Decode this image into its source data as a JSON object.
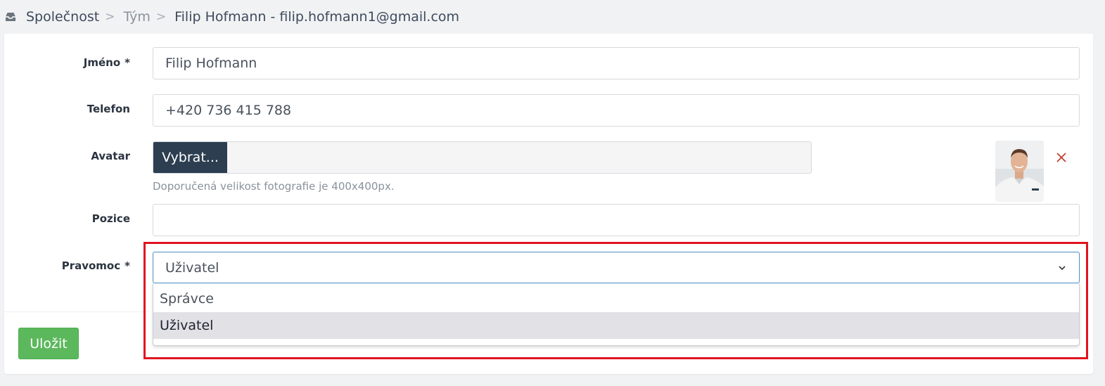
{
  "breadcrumb": {
    "items": [
      "Společnost",
      "Tým",
      "Filip Hofmann - filip.hofmann1@gmail.com"
    ],
    "separator": ">"
  },
  "form": {
    "name": {
      "label": "Jméno",
      "required_mark": "*",
      "value": "Filip Hofmann"
    },
    "phone": {
      "label": "Telefon",
      "value": "+420 736 415 788"
    },
    "avatar": {
      "label": "Avatar",
      "button_label": "Vybrat...",
      "hint": "Doporučená velikost fotografie je 400x400px.",
      "remove_icon": "close-icon"
    },
    "position": {
      "label": "Pozice",
      "value": ""
    },
    "authority": {
      "label": "Pravomoc",
      "required_mark": "*",
      "selected": "Uživatel",
      "options": [
        "Správce",
        "Uživatel"
      ]
    }
  },
  "actions": {
    "save_label": "Uložit"
  },
  "colors": {
    "primary_dark": "#2c3e50",
    "success": "#5cb85c",
    "danger": "#c0392b",
    "highlight": "#e0131f"
  }
}
